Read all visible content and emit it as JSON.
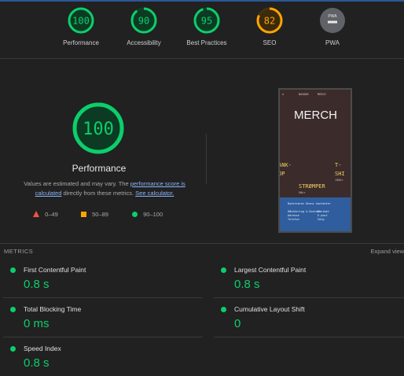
{
  "colors": {
    "pass": "#0cce6b",
    "average": "#ffa400",
    "fail": "#ff4e42",
    "na": "#9e9e9e",
    "link": "#8ab4f8"
  },
  "categories": [
    {
      "label": "Performance",
      "score": "100",
      "fraction": 1.0,
      "status": "pass"
    },
    {
      "label": "Accessibility",
      "score": "90",
      "fraction": 0.9,
      "status": "pass"
    },
    {
      "label": "Best Practices",
      "score": "95",
      "fraction": 0.95,
      "status": "pass"
    },
    {
      "label": "SEO",
      "score": "82",
      "fraction": 0.82,
      "status": "average"
    },
    {
      "label": "PWA",
      "badge": "PWA",
      "status": "na"
    }
  ],
  "summary": {
    "score": "100",
    "title": "Performance",
    "desc_prefix": "Values are estimated and may vary. The ",
    "score_link": "performance score is calculated",
    "desc_middle": " directly from these metrics. ",
    "calc_link": "See calculator."
  },
  "legend": {
    "fail": "0–49",
    "average": "50–89",
    "pass": "90–100"
  },
  "screenshot": {
    "nav": [
      "≡",
      "NAVBAR",
      "MERCH"
    ],
    "title": "MERCH",
    "left_text": "ANK-\nOP",
    "right_text": "T-\nSHI",
    "price_right": "150kr",
    "product": "STRØMPER",
    "price_left": "50kr",
    "footer_head": "Nyhetsbrev  Ukens kontakter",
    "footer_col1": "Håndtering & Kontakt\nAdresse\nTelefon",
    "footer_col2": "Kontakt\nE-post\nFølg"
  },
  "metrics_header": {
    "title": "METRICS",
    "expand": "Expand view"
  },
  "metrics": [
    {
      "name": "First Contentful Paint",
      "value": "0.8 s"
    },
    {
      "name": "Largest Contentful Paint",
      "value": "0.8 s"
    },
    {
      "name": "Total Blocking Time",
      "value": "0 ms"
    },
    {
      "name": "Cumulative Layout Shift",
      "value": "0"
    },
    {
      "name": "Speed Index",
      "value": "0.8 s"
    }
  ]
}
